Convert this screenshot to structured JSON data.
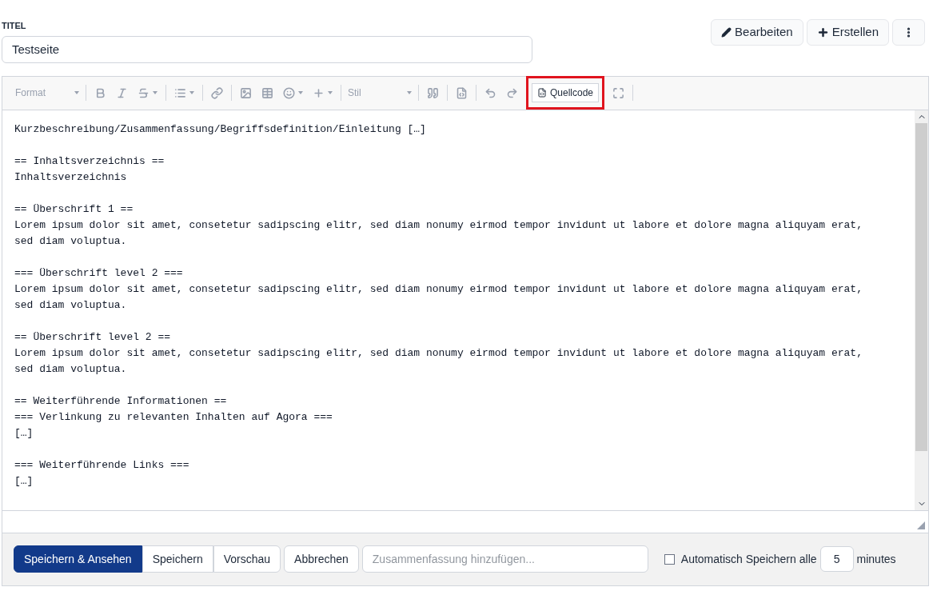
{
  "title_field": {
    "label": "TITEL",
    "value": "Testseite"
  },
  "actions": [
    {
      "kind": "edit",
      "label": "Bearbeiten"
    },
    {
      "kind": "create",
      "label": "Erstellen"
    },
    {
      "kind": "more"
    }
  ],
  "toolbar": {
    "format": "Format",
    "style": "Stil",
    "source": {
      "label": "Quellcode",
      "highlighted": true
    }
  },
  "source_text": "Kurzbeschreibung/Zusammenfassung/Begriffsdefinition/Einleitung […]\n\n== Inhaltsverzeichnis ==\nInhaltsverzeichnis\n\n== Überschrift 1 ==\nLorem ipsum dolor sit amet, consetetur sadipscing elitr, sed diam nonumy eirmod tempor invidunt ut labore et dolore magna aliquyam erat, sed diam voluptua.\n\n=== Überschrift level 2 ===\nLorem ipsum dolor sit amet, consetetur sadipscing elitr, sed diam nonumy eirmod tempor invidunt ut labore et dolore magna aliquyam erat, sed diam voluptua.\n\n== Überschrift level 2 ==\nLorem ipsum dolor sit amet, consetetur sadipscing elitr, sed diam nonumy eirmod tempor invidunt ut labore et dolore magna aliquyam erat, sed diam voluptua.\n\n== Weiterführende Informationen ==\n=== Verlinkung zu relevanten Inhalten auf Agora ===\n[…]\n\n=== Weiterführende Links ===\n[…]",
  "footer": {
    "buttons": [
      {
        "label": "Speichern & Ansehen",
        "primary": true
      },
      {
        "label": "Speichern",
        "primary": false
      },
      {
        "label": "Vorschau",
        "primary": false
      }
    ],
    "cancel": "Abbrechen",
    "summary_placeholder": "Zusammenfassung hinzufügen...",
    "autosave": {
      "checked": false,
      "label": "Automatisch Speichern",
      "word": "alle",
      "minutes": "5",
      "unit": "minutes"
    }
  }
}
